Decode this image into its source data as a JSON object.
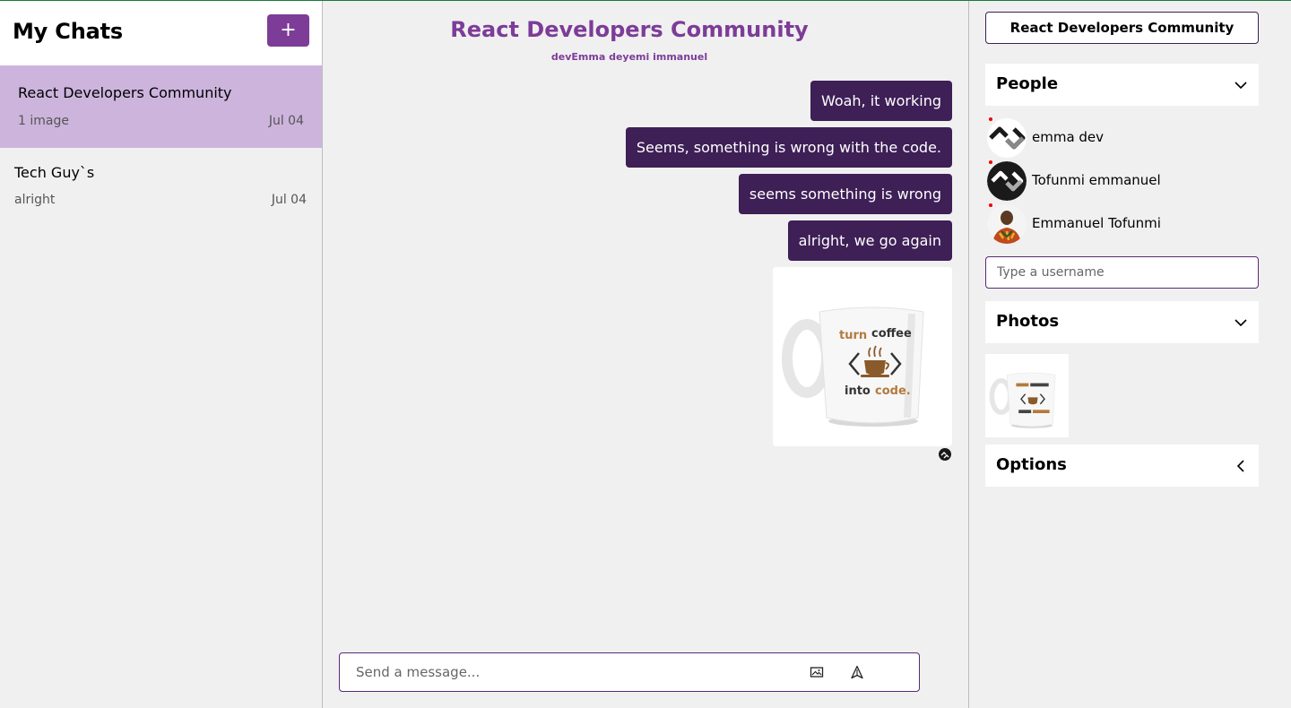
{
  "sidebar": {
    "title": "My Chats",
    "new_chat_label": "+",
    "chats": [
      {
        "title": "React Developers Community",
        "last_message": "1 image",
        "date": "Jul 04",
        "active": true
      },
      {
        "title": "Tech Guy`s",
        "last_message": "alright",
        "date": "Jul 04",
        "active": false
      }
    ]
  },
  "chat": {
    "title": "React Developers Community",
    "members": "devEmma deyemi immanuel",
    "messages": [
      {
        "text": "Woah, it working"
      },
      {
        "text": "Seems, something is wrong with the code."
      },
      {
        "text": "seems something is wrong"
      },
      {
        "text": "alright, we go again"
      }
    ],
    "image_message": {
      "line1_a": "turn",
      "line1_b": "coffee",
      "line2_a": "into",
      "line2_b": "code."
    },
    "composer": {
      "placeholder": "Send a message...",
      "image_icon": "image-icon",
      "send_icon": "send-icon"
    }
  },
  "settings": {
    "chat_name": "React Developers Community",
    "people_title": "People",
    "people": [
      {
        "name": "emma dev",
        "avatar": "logo"
      },
      {
        "name": "Tofunmi emmanuel",
        "avatar": "logo-dark"
      },
      {
        "name": "Emmanuel Tofunmi",
        "avatar": "photo"
      }
    ],
    "username_placeholder": "Type a username",
    "photos_title": "Photos",
    "options_title": "Options"
  },
  "colors": {
    "accent": "#7d3c98",
    "bubble": "#3e1f56",
    "active_chat": "#cdb4dd",
    "background": "#f0f0f0"
  }
}
